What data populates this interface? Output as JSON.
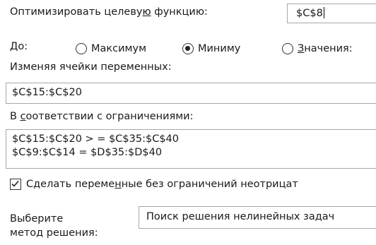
{
  "objective": {
    "label_prefix": "Оптимизировать целеву",
    "label_accel": "ю",
    "label_suffix": " функцию:",
    "value": "$C$8"
  },
  "to": {
    "label": "До:",
    "options": [
      {
        "label": "Максимум",
        "checked": false
      },
      {
        "label": "Миниму",
        "checked": true
      },
      {
        "label_accel": "З",
        "label_rest": "начения:",
        "checked": false
      }
    ]
  },
  "variables": {
    "label": "Изменяя ячейки переменных:",
    "value": "$C$15:$C$20"
  },
  "constraints": {
    "label_prefix": "В ",
    "label_accel": "с",
    "label_suffix": "оответствии с ограничениями:",
    "items": [
      "$C$15:$C$20 > = $C$35:$C$40",
      "$C$9:$C$14 = $D$35:$D$40"
    ]
  },
  "nonnegative": {
    "label_prefix": "Сделать переме",
    "label_accel": "н",
    "label_suffix": "ные без ограничений неотрицат",
    "checked": true
  },
  "method": {
    "label_line1": "Выберите",
    "label_line2": "метод решения:",
    "value": "Поиск решения нелинейных задач"
  }
}
